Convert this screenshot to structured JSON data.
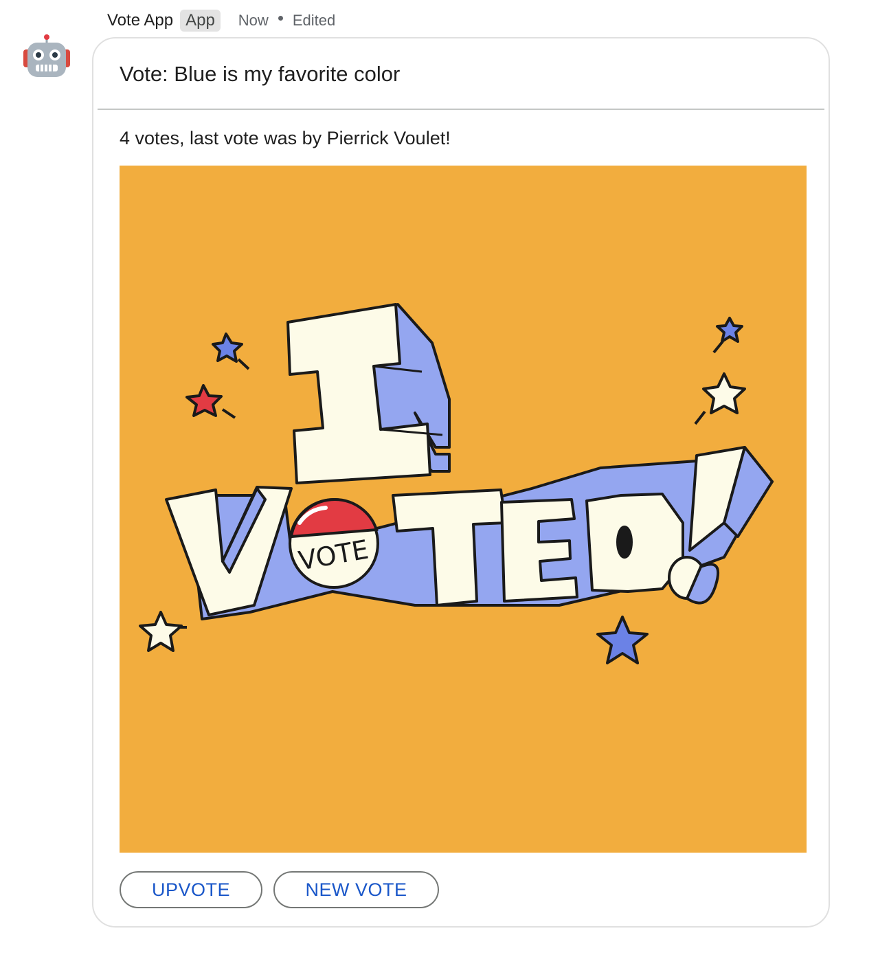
{
  "header": {
    "sender_name": "Vote App",
    "badge": "App",
    "timestamp": "Now",
    "edited": "Edited"
  },
  "avatar": {
    "icon": "robot-icon"
  },
  "card": {
    "title": "Vote: Blue is my favorite color",
    "text": "4 votes, last vote was by Pierrick Voulet!",
    "image": {
      "words": [
        "I",
        "VOTED!"
      ],
      "badge_text": "VOTE",
      "background_color": "#f2ad3e"
    },
    "buttons": {
      "upvote": "UPVOTE",
      "new_vote": "NEW VOTE"
    }
  },
  "colors": {
    "accent": "#1a57c9",
    "image_bg": "#f2ad3e",
    "letter_fill": "#fdfbe8",
    "letter_shadow": "#94a6f0",
    "star_red": "#e23b43"
  }
}
